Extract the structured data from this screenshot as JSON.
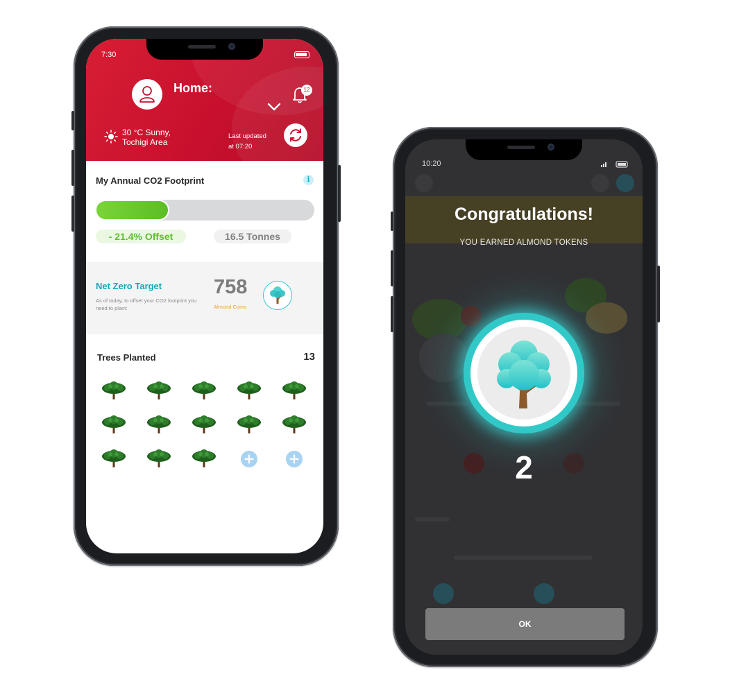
{
  "phone_left": {
    "status_time": "7:30",
    "header": {
      "title": "Home:",
      "notification_count": "12",
      "weather_line1": "30 °C Sunny,",
      "weather_line2": "Tochigi Area",
      "last_updated_line1": "Last updated",
      "last_updated_line2": "at 07:20"
    },
    "footprint": {
      "title": "My Annual CO2 Footprint",
      "info_icon_label": "i",
      "progress_fraction": 0.34,
      "offset_label": "- 21.4% Offset",
      "tonnes_label": "16.5 Tonnes"
    },
    "net_zero": {
      "title": "Net Zero Target",
      "description": "As of today, to offset your CO2 footprint you need to plant:",
      "coins_value": "758",
      "coins_label": "Almond Coins"
    },
    "trees": {
      "title": "Trees Planted",
      "count": "13"
    }
  },
  "phone_right": {
    "status_time": "10:20",
    "title": "Congratulations!",
    "subtitle": "YOU EARNED ALMOND TOKENS",
    "token_count": "2",
    "ok_label": "OK"
  },
  "colors": {
    "brand_red": "#c8102e",
    "progress_green": "#5bbd25",
    "teal": "#14a6bd",
    "coin_orange": "#f0a020"
  },
  "icons": [
    "user-icon",
    "chevron-down-icon",
    "bell-icon",
    "sun-icon",
    "refresh-icon",
    "info-icon",
    "tree-icon",
    "plus-icon"
  ]
}
